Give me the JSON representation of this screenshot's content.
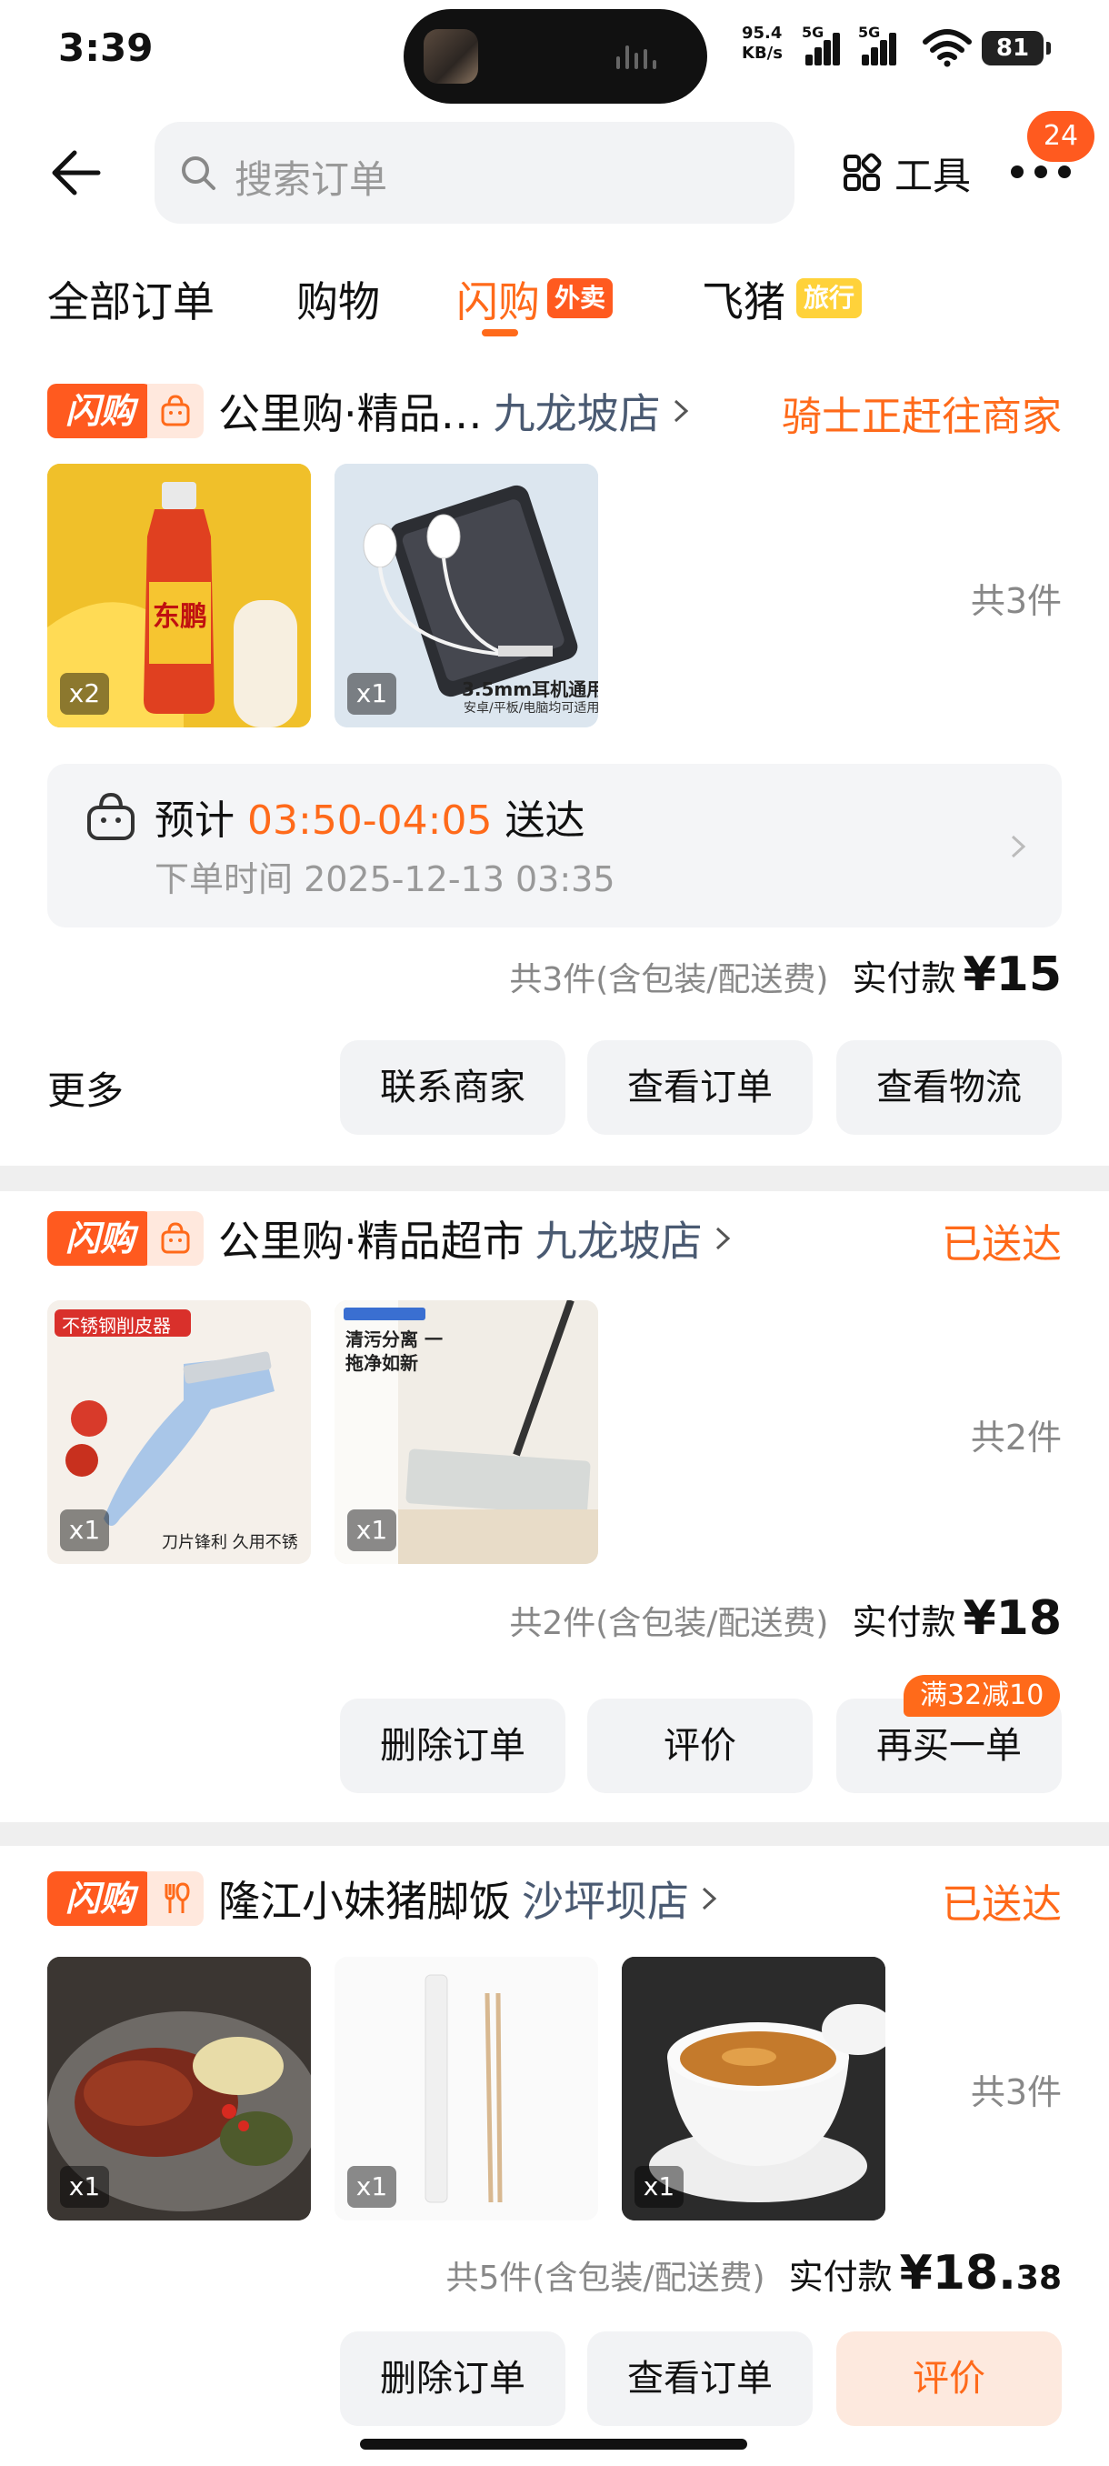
{
  "status_bar": {
    "time": "3:39",
    "net_speed": "95.4",
    "net_unit": "KB/s",
    "sig1_label": "5G",
    "sig2_label": "5G",
    "battery": "81"
  },
  "header": {
    "search_placeholder": "搜索订单",
    "tools_label": "工具",
    "more_badge": "24"
  },
  "tabs": [
    {
      "label": "全部订单"
    },
    {
      "label": "购物"
    },
    {
      "label": "闪购",
      "badge": "外卖"
    },
    {
      "label": "飞猪",
      "badge": "旅行"
    }
  ],
  "colors": {
    "accent": "#ff6a1a",
    "badge": "#ff5a1f",
    "travel_badge": "#ffd23a"
  },
  "orders": [
    {
      "tag": "闪购",
      "shop_icon": "shopping-bag-icon",
      "shop_name": "公里购·精品…",
      "branch": "九龙坡店",
      "status": "骑士正赶往商家",
      "items": [
        {
          "name": "东鹏特饮",
          "qty": "x2"
        },
        {
          "name": "3.5mm耳机通用",
          "caption": "3.5mm耳机通用",
          "subcaption": "安卓/平板/电脑均可适用",
          "qty": "x1"
        }
      ],
      "count": "共3件",
      "eta_prefix": "预计",
      "eta_time": "03:50-04:05",
      "eta_suffix": "送达",
      "order_time": "下单时间 2025-12-13 03:35",
      "paid_note": "共3件(含包装/配送费)",
      "paid_label": "实付款",
      "paid_amount": "¥15",
      "more_label": "更多",
      "buttons": [
        "联系商家",
        "查看订单",
        "查看物流"
      ]
    },
    {
      "tag": "闪购",
      "shop_icon": "shopping-bag-icon",
      "shop_name": "公里购·精品超市",
      "branch": "九龙坡店",
      "status": "已送达",
      "items": [
        {
          "name": "不锈钢削皮器",
          "caption": "不锈钢削皮器",
          "subcaption": "刀片锋利 久用不锈",
          "qty": "x1"
        },
        {
          "name": "拖把",
          "caption": "清污分离 一拖净如新",
          "qty": "x1"
        }
      ],
      "count": "共2件",
      "paid_note": "共2件(含包装/配送费)",
      "paid_label": "实付款",
      "paid_amount": "¥18",
      "promo": "满32减10",
      "buttons": [
        "删除订单",
        "评价",
        "再买一单"
      ]
    },
    {
      "tag": "闪购",
      "shop_icon": "fork-spoon-icon",
      "shop_name": "隆江小妹猪脚饭",
      "branch": "沙坪坝店",
      "status": "已送达",
      "items": [
        {
          "name": "猪脚饭",
          "qty": "x1"
        },
        {
          "name": "筷子",
          "qty": "x1"
        },
        {
          "name": "炖汤",
          "qty": "x1"
        }
      ],
      "count": "共3件",
      "paid_note": "共5件(含包装/配送费)",
      "paid_label": "实付款",
      "paid_amount_int": "¥18.",
      "paid_amount_dec": "38",
      "buttons": [
        "删除订单",
        "查看订单",
        "评价"
      ]
    }
  ]
}
